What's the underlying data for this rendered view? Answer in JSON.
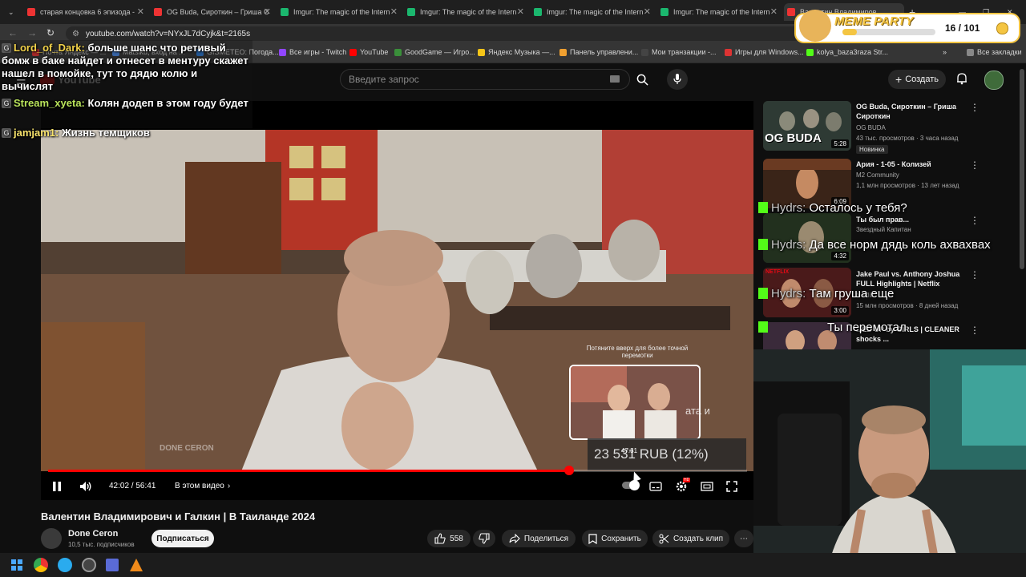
{
  "browser": {
    "tabs": [
      {
        "label": "старая концовка 6 эпизода -",
        "fav": "#e33"
      },
      {
        "label": "OG Buda, Сироткин – Гриша С",
        "fav": "#e33"
      },
      {
        "label": "Imgur: The magic of the Intern",
        "fav": "#1bb76e"
      },
      {
        "label": "Imgur: The magic of the Intern",
        "fav": "#1bb76e"
      },
      {
        "label": "Imgur: The magic of the Intern",
        "fav": "#1bb76e"
      },
      {
        "label": "Imgur: The magic of the Intern",
        "fav": "#1bb76e"
      },
      {
        "label": "Валентин Владимиров",
        "fav": "#e33"
      }
    ],
    "url": "youtube.com/watch?v=NYxJL7dCyjk&t=2165s",
    "bookmarks": [
      "Почта Яндекс — ...",
      "Matsiku, вход на ...",
      "GISMETEO: Погода...",
      "Все игры - Twitch",
      "YouTube",
      "GoodGame — Игро...",
      "Яндекс Музыка —...",
      "Панель управлени...",
      "Мои транзакции -...",
      "Игры для Windows...",
      "kolya_baza3raza Str..."
    ],
    "all_bookmarks": "Все закладки"
  },
  "youtube": {
    "logo": "YouTube",
    "search_placeholder": "Введите запрос",
    "create_label": "Создать"
  },
  "chat": [
    {
      "user": "Lord_of_Dark:",
      "text": "больше шанс что ретивый бомж в баке найдет и отнесет в ментуру скажет нашел в помойке, тут то дядю колю и вычислят"
    },
    {
      "user": "Stream_xyeta:",
      "text": "Колян додеп в этом году будет"
    },
    {
      "user": "jamjam1:",
      "text": "Жизнь темщиков"
    }
  ],
  "player": {
    "progress": 0.745,
    "time": "42:02 / 56:41",
    "chapter": "В этом видео",
    "watermark": "DONE CERON",
    "hint": "Потяните вверх для более точной перемотки",
    "thumb_time": "47:31",
    "donation": "23 531 RUB (12%)",
    "subtitle_fragment": "ата и"
  },
  "video": {
    "title": "Валентин Владимирович и Галкин | В Таиланде 2024",
    "channel": "Done Ceron",
    "subscribers": "10,5 тыс. подписчиков",
    "subscribe": "Подписаться",
    "likes": "558",
    "share": "Поделиться",
    "save": "Сохранить",
    "clip": "Создать клип"
  },
  "sidebar": [
    {
      "title": "OG Buda, Сироткин – Гриша Сироткин",
      "channel": "OG BUDA",
      "meta": "43 тыс. просмотров · 3 часа назад",
      "badge": "Новинка",
      "duration": "5:28",
      "thumb_text": "OG BUDA"
    },
    {
      "title": "Ария - 1-05 - Колизей",
      "channel": "M2 Community",
      "meta": "1,1 млн просмотров · 13 лет назад",
      "duration": "6:09"
    },
    {
      "title": "Ты был прав...",
      "channel": "Звездный Капитан",
      "meta": "",
      "duration": "4:32"
    },
    {
      "title": "Jake Paul vs. Anthony Joshua FULL Highlights | Netflix",
      "channel": "Netflix",
      "meta": "15 млн просмотров · 8 дней назад",
      "duration": "3:00"
    },
    {
      "title": "...ED UP by GIRLS | CLEANER shocks ...",
      "channel": "",
      "meta": "",
      "duration": ""
    }
  ],
  "kick_chat": [
    {
      "user": "Hydrs:",
      "text": "Осталось у тебя?"
    },
    {
      "user": "Hydrs:",
      "text": "Да все норм дядь коль ахвахвах"
    },
    {
      "user": "Hydrs:",
      "text": "Там груша еще"
    },
    {
      "user": "",
      "text": "Ты перемотал"
    }
  ],
  "meme_party": {
    "label": "MEME PARTY",
    "progress": "16 / 101"
  }
}
